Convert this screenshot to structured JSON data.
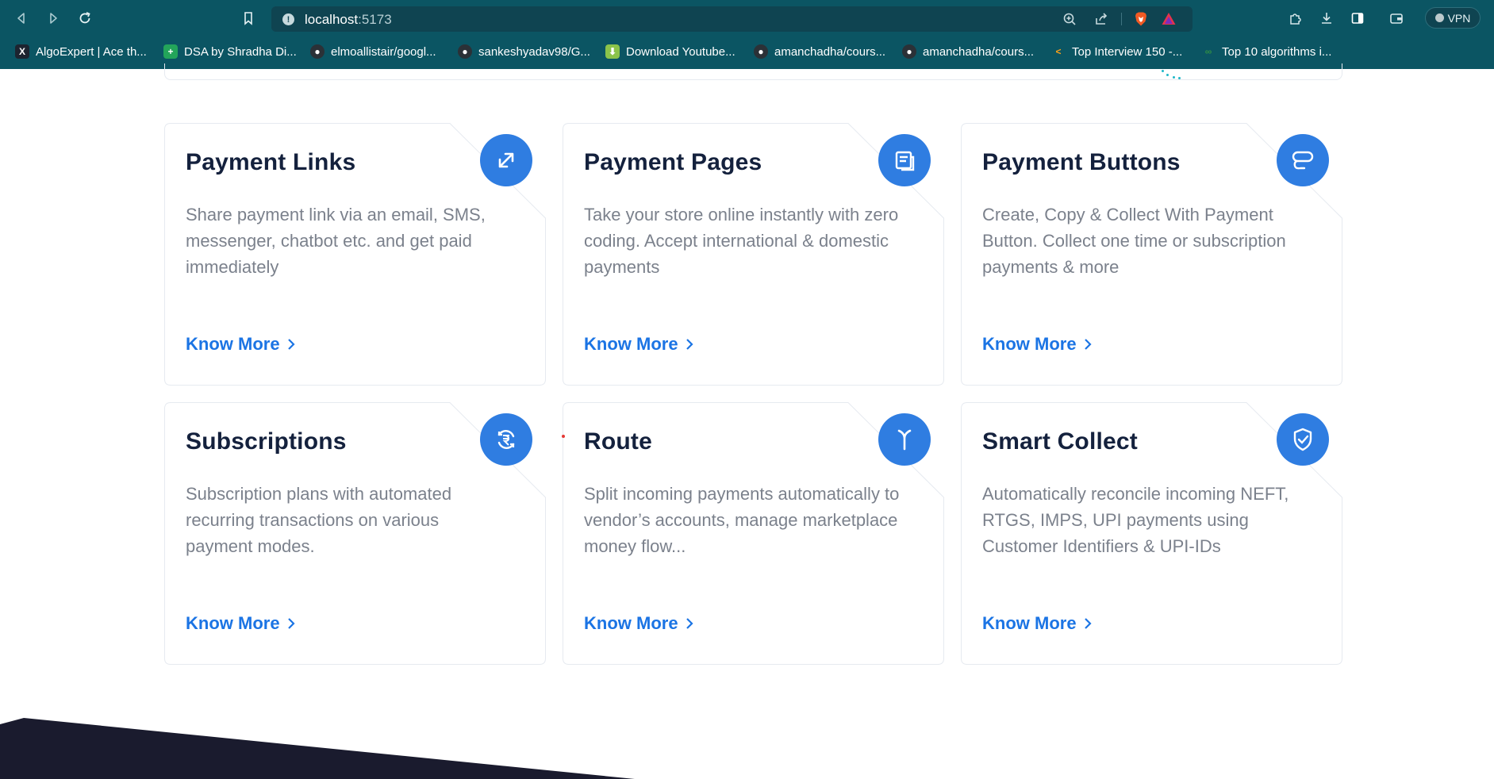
{
  "browser": {
    "url_host": "localhost",
    "url_port": ":5173",
    "vpn_label": "VPN",
    "bookmarks": [
      {
        "label": "AlgoExpert | Ace th...",
        "icon": "algoexpert-icon"
      },
      {
        "label": "DSA by Shradha Di...",
        "icon": "sheets-icon"
      },
      {
        "label": "elmoallistair/googl...",
        "icon": "github-icon"
      },
      {
        "label": "sankeshyadav98/G...",
        "icon": "github-icon"
      },
      {
        "label": "Download Youtube...",
        "icon": "download-icon"
      },
      {
        "label": "amanchadha/cours...",
        "icon": "github-icon"
      },
      {
        "label": "amanchadha/cours...",
        "icon": "github-icon"
      },
      {
        "label": "Top Interview 150 -...",
        "icon": "leetcode-icon"
      },
      {
        "label": "Top 10 algorithms i...",
        "icon": "geeksforgeeks-icon"
      }
    ]
  },
  "colors": {
    "chrome": "#0b5563",
    "title": "#14213d",
    "body_text": "#7b818c",
    "link": "#1b74e4",
    "icon_bg": "#2f7de1"
  },
  "cards": [
    {
      "title": "Payment Links",
      "description": "Share payment link via an email, SMS, messenger, chatbot etc. and get paid immediately",
      "link": "Know More",
      "icon": "payment-links-icon"
    },
    {
      "title": "Payment Pages",
      "description": "Take your store online instantly with zero coding. Accept international & domestic payments",
      "link": "Know More",
      "icon": "payment-pages-icon"
    },
    {
      "title": "Payment Buttons",
      "description": "Create, Copy & Collect With Payment Button. Collect one time or subscription payments & more",
      "link": "Know More",
      "icon": "payment-buttons-icon"
    },
    {
      "title": "Subscriptions",
      "description": "Subscription plans with automated recurring transactions on various payment modes.",
      "link": "Know More",
      "icon": "subscriptions-rupee-icon"
    },
    {
      "title": "Route",
      "description": "Split incoming payments automatically to vendor’s accounts, manage marketplace money flow...",
      "link": "Know More",
      "icon": "route-split-icon"
    },
    {
      "title": "Smart Collect",
      "description": "Automatically reconcile incoming NEFT, RTGS, IMPS, UPI payments using Customer Identifiers & UPI-IDs",
      "link": "Know More",
      "icon": "shield-check-icon"
    }
  ]
}
